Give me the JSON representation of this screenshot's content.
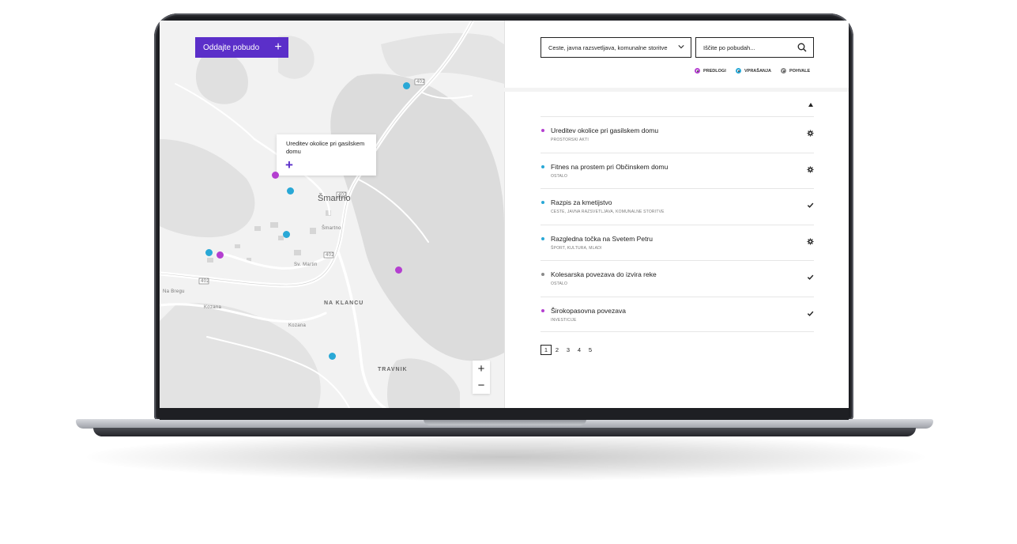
{
  "map": {
    "submit_button": "Oddajte pobudo",
    "popup_text": "Ureditev okolice pri gasilskem domu",
    "place_labels": {
      "smartno": "Šmartno",
      "na_klancu": "NA KLANCU",
      "travnik": "TRAVNIK",
      "na_bregu": "Na Bregu",
      "kozana": "Kozana",
      "kozana2": "Kozana",
      "slovenska": "Šmartno",
      "sv_martin": "Sv. Martin"
    },
    "road_numbers": {
      "r402a": "402",
      "r402b": "402",
      "r402c": "402",
      "r402d": "402"
    },
    "zoom_in": "+",
    "zoom_out": "−"
  },
  "filter": {
    "selected": "Ceste, javna razsvetljava, komunalne storitve",
    "search_placeholder": "Iščite po pobudah..."
  },
  "legend": [
    {
      "label": "PREDLOGI",
      "color": "#b43fd0"
    },
    {
      "label": "VPRAŠANJA",
      "color": "#29a8d6"
    },
    {
      "label": "POHVALE",
      "color": "#8a8a8a"
    }
  ],
  "items": [
    {
      "title": "Ureditev okolice pri gasilskem domu",
      "category": "PROSTORSKI AKTI",
      "color": "#b43fd0",
      "status": "gear-icon"
    },
    {
      "title": "Fitnes na prostem pri Občinskem domu",
      "category": "OSTALO",
      "color": "#29a8d6",
      "status": "gear-icon"
    },
    {
      "title": "Razpis za kmetijstvo",
      "category": "CESTE, JAVNA RAZSVETLJAVA, KOMUNALNE STORITVE",
      "color": "#29a8d6",
      "status": "check-icon"
    },
    {
      "title": "Razgledna točka na Svetem Petru",
      "category": "ŠPORT, KULTURA, MLADI",
      "color": "#29a8d6",
      "status": "gear-icon"
    },
    {
      "title": "Kolesarska povezava do izvira reke",
      "category": "OSTALO",
      "color": "#8a8a8a",
      "status": "check-icon"
    },
    {
      "title": "Širokopasovna povezava",
      "category": "INVESTICIJE",
      "color": "#b43fd0",
      "status": "check-icon"
    }
  ],
  "pagination": [
    "1",
    "2",
    "3",
    "4",
    "5"
  ],
  "current_page": "1"
}
